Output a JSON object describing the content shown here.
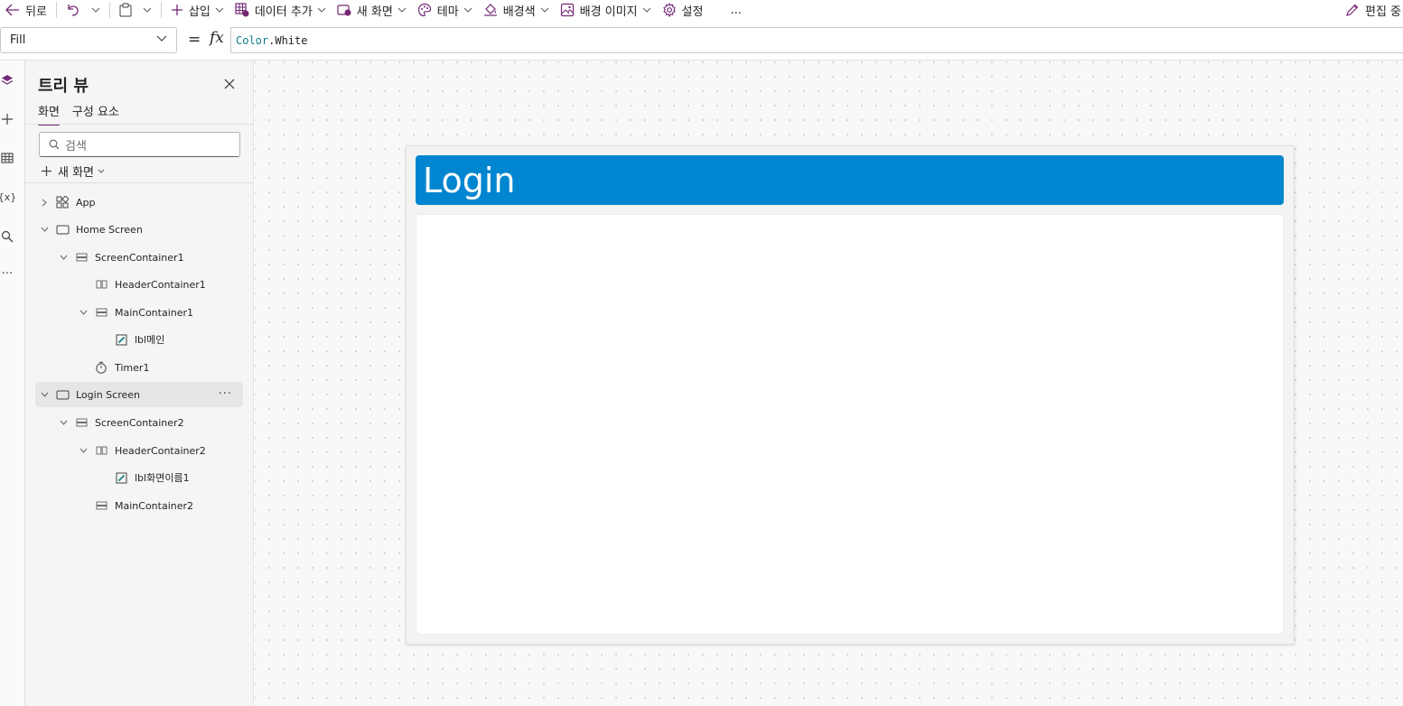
{
  "toolbar": {
    "back_label": "뒤로",
    "insert_label": "삽입",
    "add_data_label": "데이터 추가",
    "new_screen_label": "새 화면",
    "theme_label": "테마",
    "bg_color_label": "배경색",
    "bg_image_label": "배경 이미지",
    "settings_label": "설정",
    "overflow_label": "...",
    "editing_label": "편집 중"
  },
  "formula_bar": {
    "property": "Fill",
    "equals": "=",
    "fx": "fx",
    "formula_object": "Color",
    "formula_property": ".White"
  },
  "tree_view": {
    "title": "트리 뷰",
    "tabs": [
      "화면",
      "구성 요소"
    ],
    "search_placeholder": "검색",
    "new_screen_label": "새 화면",
    "nodes": [
      {
        "name": "App",
        "icon": "app-icon",
        "expand": "collapsed"
      },
      {
        "name": "Home Screen",
        "icon": "screen-icon",
        "expand": "expanded"
      },
      {
        "name": "ScreenContainer1",
        "icon": "vertical-container-icon",
        "expand": "expanded"
      },
      {
        "name": "HeaderContainer1",
        "icon": "horizontal-container-icon",
        "expand": "none"
      },
      {
        "name": "MainContainer1",
        "icon": "vertical-container-icon",
        "expand": "expanded"
      },
      {
        "name": "lbl메인",
        "icon": "label-icon",
        "expand": "none"
      },
      {
        "name": "Timer1",
        "icon": "timer-icon",
        "expand": "none"
      },
      {
        "name": "Login Screen",
        "icon": "screen-icon",
        "expand": "expanded",
        "selected": true
      },
      {
        "name": "ScreenContainer2",
        "icon": "vertical-container-icon",
        "expand": "expanded"
      },
      {
        "name": "HeaderContainer2",
        "icon": "horizontal-container-icon",
        "expand": "expanded"
      },
      {
        "name": "lbl화면이름1",
        "icon": "label-icon",
        "expand": "none"
      },
      {
        "name": "MainContainer2",
        "icon": "vertical-container-icon",
        "expand": "none"
      }
    ],
    "more_label": "···"
  },
  "canvas": {
    "header_title": "Login"
  },
  "colors": {
    "accent": "#742774",
    "header_bar": "#0085d0",
    "label_icon": "#0e7c86"
  }
}
